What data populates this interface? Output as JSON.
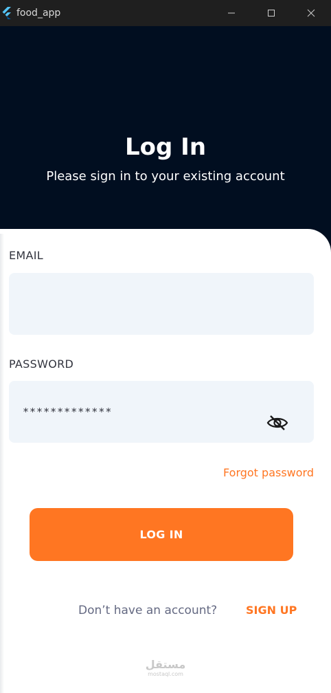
{
  "window": {
    "title": "food_app",
    "icon": "flutter-icon"
  },
  "header": {
    "title": "Log In",
    "subtitle": "Please sign in to your existing account"
  },
  "form": {
    "email_label": "EMAIL",
    "email_value": "",
    "password_label": "PASSWORD",
    "password_value": "*************",
    "password_visibility_icon": "eye-off-icon",
    "forgot_label": "Forgot password",
    "login_label": "LOG IN"
  },
  "signup": {
    "prompt": "Don’t have an account?",
    "link": "SIGN UP"
  },
  "watermark": {
    "main": "مستقل",
    "sub": "mostaql.com"
  },
  "colors": {
    "accent": "#FF7622",
    "header_bg": "#010E20",
    "field_bg": "#F0F5FA"
  }
}
